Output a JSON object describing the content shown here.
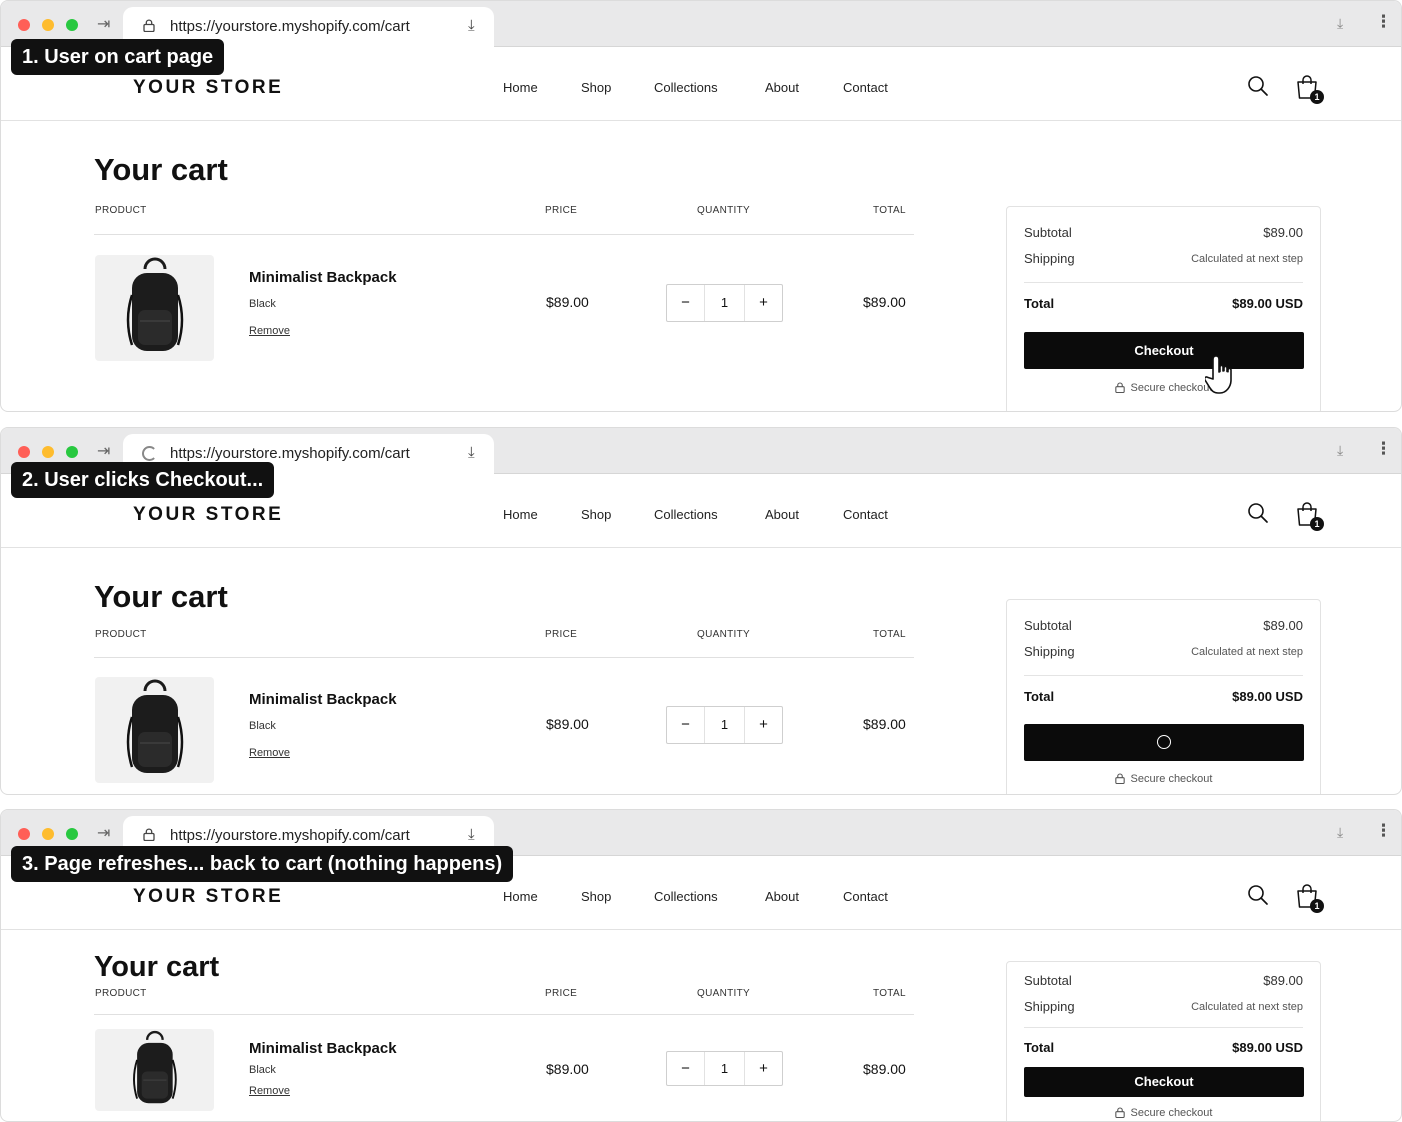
{
  "browser": {
    "url": "https://yourstore.myshopify.com/cart"
  },
  "steps": [
    "1. User on cart page",
    "2. User clicks Checkout...",
    "3. Page refreshes... back to cart (nothing happens)"
  ],
  "store": {
    "logo": "YOUR STORE",
    "nav": [
      "Home",
      "Shop",
      "Collections",
      "About",
      "Contact"
    ],
    "cart_count": "1"
  },
  "cart": {
    "title": "Your cart",
    "headers": {
      "product": "PRODUCT",
      "price": "PRICE",
      "quantity": "QUANTITY",
      "total": "TOTAL"
    },
    "item": {
      "name": "Minimalist Backpack",
      "variant": "Black",
      "remove": "Remove",
      "price": "$89.00",
      "quantity": "1",
      "line_total": "$89.00",
      "qty_minus": "−",
      "qty_plus": "+"
    }
  },
  "summary": {
    "subtotal_label": "Subtotal",
    "subtotal_value": "$89.00",
    "shipping_label": "Shipping",
    "shipping_value": "Calculated at next step",
    "total_label": "Total",
    "total_value": "$89.00 USD",
    "checkout_label": "Checkout",
    "secure_label": "Secure checkout"
  },
  "icons": {
    "forward": "forward-arrow-icon",
    "lock": "lock-icon",
    "loading": "loading-spinner-icon",
    "download": "download-icon",
    "menu": "kebab-menu-icon",
    "search": "search-icon",
    "cart": "shopping-bag-icon",
    "cursor": "hand-pointer-cursor-icon"
  },
  "colors": {
    "button": "#0b0b0b",
    "badge": "#111111",
    "chrome": "#e9e9ea"
  }
}
